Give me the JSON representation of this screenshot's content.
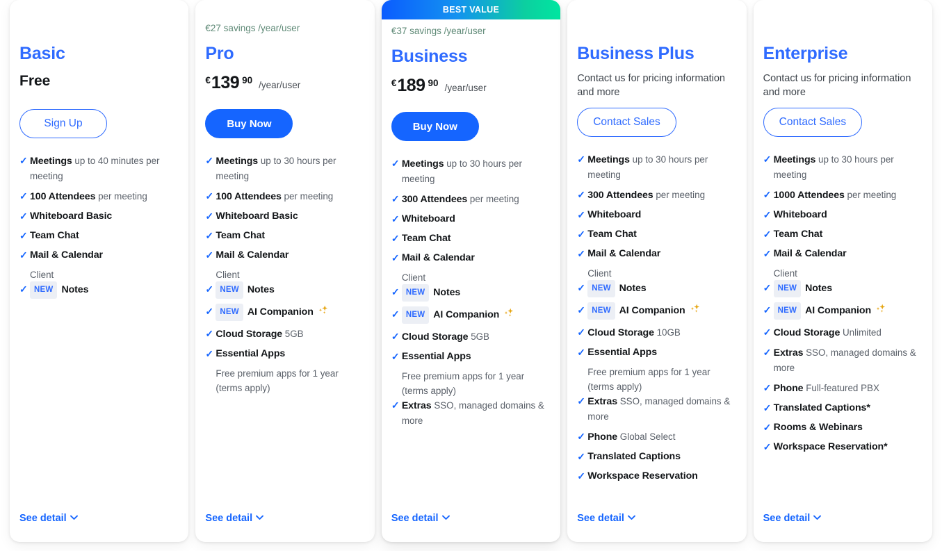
{
  "ui": {
    "best_value_label": "BEST VALUE",
    "see_detail_label": "See detail",
    "chevron_icon": "⌄",
    "check_icon": "✓",
    "new_badge": "NEW",
    "free_label": "Free",
    "currency": "€",
    "cents_pro": "90",
    "cents_business": "90"
  },
  "colors": {
    "accent_blue": "#1565ff",
    "heading_blue": "#2f6bff",
    "savings_green": "#5f8a77",
    "ribbon_start": "#0b5cff",
    "ribbon_end": "#00e6a0",
    "sparkle_gold": "#e6a612",
    "badge_bg": "#eceff5"
  },
  "plans": [
    {
      "name": "Basic",
      "savings": "",
      "price_type": "free",
      "price_free": "Free",
      "currency": "€",
      "amount": "",
      "cents": "",
      "period": "",
      "contact_note": "",
      "cta_label": "Sign Up",
      "cta_style": "outline",
      "featured": false,
      "features": [
        {
          "label": "Meetings",
          "desc": " up to 40 minutes per meeting",
          "sub": "",
          "new": false,
          "sparkle": false
        },
        {
          "label": "100 Attendees",
          "desc": " per meeting",
          "sub": "",
          "new": false,
          "sparkle": false
        },
        {
          "label": "Whiteboard Basic",
          "desc": "",
          "sub": "",
          "new": false,
          "sparkle": false
        },
        {
          "label": "Team Chat",
          "desc": "",
          "sub": "",
          "new": false,
          "sparkle": false
        },
        {
          "label": "Mail & Calendar",
          "desc": "",
          "sub": "Client",
          "new": false,
          "sparkle": false
        },
        {
          "label": "Notes",
          "desc": "",
          "sub": "",
          "new": true,
          "sparkle": false
        }
      ]
    },
    {
      "name": "Pro",
      "savings": "€27 savings /year/user",
      "price_type": "amount",
      "price_free": "",
      "currency": "€",
      "amount": "139",
      "cents": "90",
      "period": "/year/user",
      "contact_note": "",
      "cta_label": "Buy Now",
      "cta_style": "solid",
      "featured": false,
      "features": [
        {
          "label": "Meetings",
          "desc": " up to 30 hours per meeting",
          "sub": "",
          "new": false,
          "sparkle": false
        },
        {
          "label": "100 Attendees",
          "desc": " per meeting",
          "sub": "",
          "new": false,
          "sparkle": false
        },
        {
          "label": "Whiteboard Basic",
          "desc": "",
          "sub": "",
          "new": false,
          "sparkle": false
        },
        {
          "label": "Team Chat",
          "desc": "",
          "sub": "",
          "new": false,
          "sparkle": false
        },
        {
          "label": "Mail & Calendar",
          "desc": "",
          "sub": "Client",
          "new": false,
          "sparkle": false
        },
        {
          "label": "Notes",
          "desc": "",
          "sub": "",
          "new": true,
          "sparkle": false
        },
        {
          "label": "AI Companion",
          "desc": "",
          "sub": "",
          "new": true,
          "sparkle": true
        },
        {
          "label": "Cloud Storage",
          "desc": " 5GB",
          "sub": "",
          "new": false,
          "sparkle": false
        },
        {
          "label": "Essential Apps",
          "desc": "",
          "sub": "Free premium apps for 1 year (terms apply)",
          "new": false,
          "sparkle": false
        }
      ]
    },
    {
      "name": "Business",
      "savings": "€37 savings /year/user",
      "price_type": "amount",
      "price_free": "",
      "currency": "€",
      "amount": "189",
      "cents": "90",
      "period": "/year/user",
      "contact_note": "",
      "cta_label": "Buy Now",
      "cta_style": "solid",
      "featured": true,
      "features": [
        {
          "label": "Meetings",
          "desc": " up to 30 hours per meeting",
          "sub": "",
          "new": false,
          "sparkle": false
        },
        {
          "label": "300 Attendees",
          "desc": " per meeting",
          "sub": "",
          "new": false,
          "sparkle": false
        },
        {
          "label": "Whiteboard",
          "desc": "",
          "sub": "",
          "new": false,
          "sparkle": false
        },
        {
          "label": "Team Chat",
          "desc": "",
          "sub": "",
          "new": false,
          "sparkle": false
        },
        {
          "label": "Mail & Calendar",
          "desc": "",
          "sub": "Client",
          "new": false,
          "sparkle": false
        },
        {
          "label": "Notes",
          "desc": "",
          "sub": "",
          "new": true,
          "sparkle": false
        },
        {
          "label": "AI Companion",
          "desc": "",
          "sub": "",
          "new": true,
          "sparkle": true
        },
        {
          "label": "Cloud Storage",
          "desc": " 5GB",
          "sub": "",
          "new": false,
          "sparkle": false
        },
        {
          "label": "Essential Apps",
          "desc": "",
          "sub": "Free premium apps for 1 year (terms apply)",
          "new": false,
          "sparkle": false
        },
        {
          "label": "Extras",
          "desc": " SSO, managed domains & more",
          "sub": "",
          "new": false,
          "sparkle": false
        }
      ]
    },
    {
      "name": "Business Plus",
      "savings": "",
      "price_type": "contact",
      "price_free": "",
      "currency": "€",
      "amount": "",
      "cents": "",
      "period": "",
      "contact_note": "Contact us for pricing information and more",
      "cta_label": "Contact Sales",
      "cta_style": "outline",
      "featured": false,
      "features": [
        {
          "label": "Meetings",
          "desc": " up to 30 hours per meeting",
          "sub": "",
          "new": false,
          "sparkle": false
        },
        {
          "label": "300 Attendees",
          "desc": " per meeting",
          "sub": "",
          "new": false,
          "sparkle": false
        },
        {
          "label": "Whiteboard",
          "desc": "",
          "sub": "",
          "new": false,
          "sparkle": false
        },
        {
          "label": "Team Chat",
          "desc": "",
          "sub": "",
          "new": false,
          "sparkle": false
        },
        {
          "label": "Mail & Calendar",
          "desc": "",
          "sub": "Client",
          "new": false,
          "sparkle": false
        },
        {
          "label": "Notes",
          "desc": "",
          "sub": "",
          "new": true,
          "sparkle": false
        },
        {
          "label": "AI Companion",
          "desc": "",
          "sub": "",
          "new": true,
          "sparkle": true
        },
        {
          "label": "Cloud Storage",
          "desc": " 10GB",
          "sub": "",
          "new": false,
          "sparkle": false
        },
        {
          "label": "Essential Apps",
          "desc": "",
          "sub": "Free premium apps for 1 year (terms apply)",
          "new": false,
          "sparkle": false
        },
        {
          "label": "Extras",
          "desc": " SSO, managed domains & more",
          "sub": "",
          "new": false,
          "sparkle": false
        },
        {
          "label": "Phone",
          "desc": " Global Select",
          "sub": "",
          "new": false,
          "sparkle": false
        },
        {
          "label": "Translated Captions",
          "desc": "",
          "sub": "",
          "new": false,
          "sparkle": false
        },
        {
          "label": "Workspace Reservation",
          "desc": "",
          "sub": "",
          "new": false,
          "sparkle": false
        }
      ]
    },
    {
      "name": "Enterprise",
      "savings": "",
      "price_type": "contact",
      "price_free": "",
      "currency": "€",
      "amount": "",
      "cents": "",
      "period": "",
      "contact_note": "Contact us for pricing information and more",
      "cta_label": "Contact Sales",
      "cta_style": "outline",
      "featured": false,
      "features": [
        {
          "label": "Meetings",
          "desc": " up to 30 hours per meeting",
          "sub": "",
          "new": false,
          "sparkle": false
        },
        {
          "label": "1000 Attendees",
          "desc": " per meeting",
          "sub": "",
          "new": false,
          "sparkle": false
        },
        {
          "label": "Whiteboard",
          "desc": "",
          "sub": "",
          "new": false,
          "sparkle": false
        },
        {
          "label": "Team Chat",
          "desc": "",
          "sub": "",
          "new": false,
          "sparkle": false
        },
        {
          "label": "Mail & Calendar",
          "desc": "",
          "sub": "Client",
          "new": false,
          "sparkle": false
        },
        {
          "label": "Notes",
          "desc": "",
          "sub": "",
          "new": true,
          "sparkle": false
        },
        {
          "label": "AI Companion",
          "desc": "",
          "sub": "",
          "new": true,
          "sparkle": true
        },
        {
          "label": "Cloud Storage",
          "desc": " Unlimited",
          "sub": "",
          "new": false,
          "sparkle": false
        },
        {
          "label": "Extras",
          "desc": " SSO, managed domains & more",
          "sub": "",
          "new": false,
          "sparkle": false
        },
        {
          "label": "Phone",
          "desc": " Full-featured PBX",
          "sub": "",
          "new": false,
          "sparkle": false
        },
        {
          "label": "Translated Captions*",
          "desc": "",
          "sub": "",
          "new": false,
          "sparkle": false
        },
        {
          "label": "Rooms & Webinars",
          "desc": "",
          "sub": "",
          "new": false,
          "sparkle": false
        },
        {
          "label": "Workspace Reservation*",
          "desc": "",
          "sub": "",
          "new": false,
          "sparkle": false
        }
      ]
    }
  ]
}
